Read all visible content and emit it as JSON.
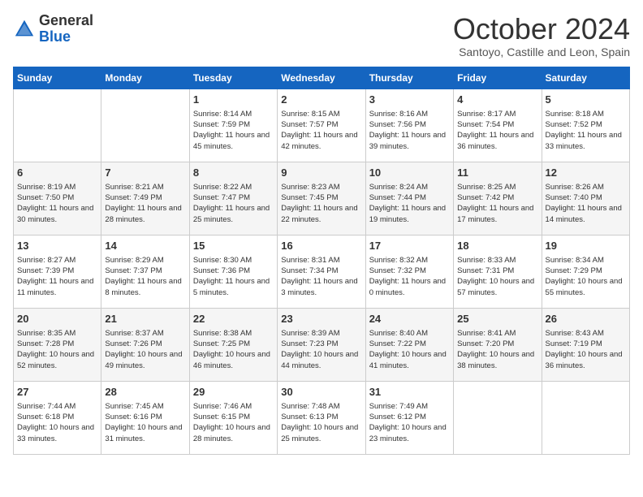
{
  "header": {
    "logo_general": "General",
    "logo_blue": "Blue",
    "month": "October 2024",
    "location": "Santoyo, Castille and Leon, Spain"
  },
  "days_of_week": [
    "Sunday",
    "Monday",
    "Tuesday",
    "Wednesday",
    "Thursday",
    "Friday",
    "Saturday"
  ],
  "weeks": [
    [
      {
        "day": "",
        "content": ""
      },
      {
        "day": "",
        "content": ""
      },
      {
        "day": "1",
        "content": "Sunrise: 8:14 AM\nSunset: 7:59 PM\nDaylight: 11 hours and 45 minutes."
      },
      {
        "day": "2",
        "content": "Sunrise: 8:15 AM\nSunset: 7:57 PM\nDaylight: 11 hours and 42 minutes."
      },
      {
        "day": "3",
        "content": "Sunrise: 8:16 AM\nSunset: 7:56 PM\nDaylight: 11 hours and 39 minutes."
      },
      {
        "day": "4",
        "content": "Sunrise: 8:17 AM\nSunset: 7:54 PM\nDaylight: 11 hours and 36 minutes."
      },
      {
        "day": "5",
        "content": "Sunrise: 8:18 AM\nSunset: 7:52 PM\nDaylight: 11 hours and 33 minutes."
      }
    ],
    [
      {
        "day": "6",
        "content": "Sunrise: 8:19 AM\nSunset: 7:50 PM\nDaylight: 11 hours and 30 minutes."
      },
      {
        "day": "7",
        "content": "Sunrise: 8:21 AM\nSunset: 7:49 PM\nDaylight: 11 hours and 28 minutes."
      },
      {
        "day": "8",
        "content": "Sunrise: 8:22 AM\nSunset: 7:47 PM\nDaylight: 11 hours and 25 minutes."
      },
      {
        "day": "9",
        "content": "Sunrise: 8:23 AM\nSunset: 7:45 PM\nDaylight: 11 hours and 22 minutes."
      },
      {
        "day": "10",
        "content": "Sunrise: 8:24 AM\nSunset: 7:44 PM\nDaylight: 11 hours and 19 minutes."
      },
      {
        "day": "11",
        "content": "Sunrise: 8:25 AM\nSunset: 7:42 PM\nDaylight: 11 hours and 17 minutes."
      },
      {
        "day": "12",
        "content": "Sunrise: 8:26 AM\nSunset: 7:40 PM\nDaylight: 11 hours and 14 minutes."
      }
    ],
    [
      {
        "day": "13",
        "content": "Sunrise: 8:27 AM\nSunset: 7:39 PM\nDaylight: 11 hours and 11 minutes."
      },
      {
        "day": "14",
        "content": "Sunrise: 8:29 AM\nSunset: 7:37 PM\nDaylight: 11 hours and 8 minutes."
      },
      {
        "day": "15",
        "content": "Sunrise: 8:30 AM\nSunset: 7:36 PM\nDaylight: 11 hours and 5 minutes."
      },
      {
        "day": "16",
        "content": "Sunrise: 8:31 AM\nSunset: 7:34 PM\nDaylight: 11 hours and 3 minutes."
      },
      {
        "day": "17",
        "content": "Sunrise: 8:32 AM\nSunset: 7:32 PM\nDaylight: 11 hours and 0 minutes."
      },
      {
        "day": "18",
        "content": "Sunrise: 8:33 AM\nSunset: 7:31 PM\nDaylight: 10 hours and 57 minutes."
      },
      {
        "day": "19",
        "content": "Sunrise: 8:34 AM\nSunset: 7:29 PM\nDaylight: 10 hours and 55 minutes."
      }
    ],
    [
      {
        "day": "20",
        "content": "Sunrise: 8:35 AM\nSunset: 7:28 PM\nDaylight: 10 hours and 52 minutes."
      },
      {
        "day": "21",
        "content": "Sunrise: 8:37 AM\nSunset: 7:26 PM\nDaylight: 10 hours and 49 minutes."
      },
      {
        "day": "22",
        "content": "Sunrise: 8:38 AM\nSunset: 7:25 PM\nDaylight: 10 hours and 46 minutes."
      },
      {
        "day": "23",
        "content": "Sunrise: 8:39 AM\nSunset: 7:23 PM\nDaylight: 10 hours and 44 minutes."
      },
      {
        "day": "24",
        "content": "Sunrise: 8:40 AM\nSunset: 7:22 PM\nDaylight: 10 hours and 41 minutes."
      },
      {
        "day": "25",
        "content": "Sunrise: 8:41 AM\nSunset: 7:20 PM\nDaylight: 10 hours and 38 minutes."
      },
      {
        "day": "26",
        "content": "Sunrise: 8:43 AM\nSunset: 7:19 PM\nDaylight: 10 hours and 36 minutes."
      }
    ],
    [
      {
        "day": "27",
        "content": "Sunrise: 7:44 AM\nSunset: 6:18 PM\nDaylight: 10 hours and 33 minutes."
      },
      {
        "day": "28",
        "content": "Sunrise: 7:45 AM\nSunset: 6:16 PM\nDaylight: 10 hours and 31 minutes."
      },
      {
        "day": "29",
        "content": "Sunrise: 7:46 AM\nSunset: 6:15 PM\nDaylight: 10 hours and 28 minutes."
      },
      {
        "day": "30",
        "content": "Sunrise: 7:48 AM\nSunset: 6:13 PM\nDaylight: 10 hours and 25 minutes."
      },
      {
        "day": "31",
        "content": "Sunrise: 7:49 AM\nSunset: 6:12 PM\nDaylight: 10 hours and 23 minutes."
      },
      {
        "day": "",
        "content": ""
      },
      {
        "day": "",
        "content": ""
      }
    ]
  ]
}
